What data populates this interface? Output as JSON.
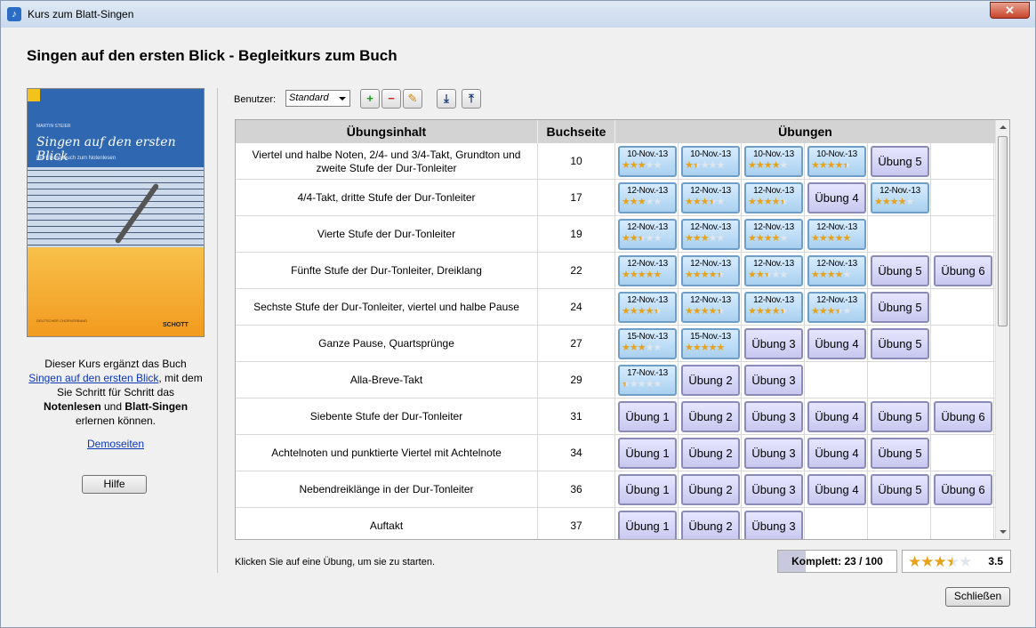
{
  "window": {
    "title": "Kurs zum Blatt-Singen",
    "close_glyph": "✕"
  },
  "page_title": "Singen auf den ersten Blick - Begleitkurs zum Buch",
  "cover": {
    "author": "MARTIN STEIER",
    "title": "Singen auf den ersten Blick",
    "subtitle": "Ein Übungsbuch zum Notenlesen",
    "logo_left": "DEUTSCHER CHORVERBAND",
    "logo_right": "SCHOTT"
  },
  "description": {
    "line1": "Dieser Kurs ergänzt das Buch",
    "link": "Singen auf den ersten Blick",
    "line2": ", mit dem Sie Schritt für Schritt das",
    "bold1": "Notenlesen",
    "and": " und ",
    "bold2": "Blatt-Singen",
    "line3": " erlernen können."
  },
  "demo_link": "Demoseiten",
  "help_button": "Hilfe",
  "toolbar": {
    "user_label": "Benutzer:",
    "user_value": "Standard",
    "add_icon": "+",
    "remove_icon": "−",
    "edit_icon": "✎",
    "save_icon": "⤓",
    "load_icon": "⤒"
  },
  "table": {
    "headers": [
      "Übungsinhalt",
      "Buchseite",
      "Übungen"
    ],
    "rows": [
      {
        "content": "Viertel und halbe Noten, 2/4- und 3/4-Takt, Grundton und zweite Stufe der Dur-Tonleiter",
        "page": "10",
        "exercises": [
          {
            "date": "10-Nov.-13",
            "stars": 3
          },
          {
            "date": "10-Nov.-13",
            "stars": 1.5
          },
          {
            "date": "10-Nov.-13",
            "stars": 4
          },
          {
            "date": "10-Nov.-13",
            "stars": 4.5
          },
          {
            "label": "Übung 5"
          }
        ]
      },
      {
        "content": "4/4-Takt, dritte Stufe der Dur-Tonleiter",
        "page": "17",
        "exercises": [
          {
            "date": "12-Nov.-13",
            "stars": 3
          },
          {
            "date": "12-Nov.-13",
            "stars": 3.5
          },
          {
            "date": "12-Nov.-13",
            "stars": 4.5
          },
          {
            "label": "Übung 4"
          },
          {
            "date": "12-Nov.-13",
            "stars": 4
          }
        ]
      },
      {
        "content": "Vierte Stufe der Dur-Tonleiter",
        "page": "19",
        "exercises": [
          {
            "date": "12-Nov.-13",
            "stars": 2.5
          },
          {
            "date": "12-Nov.-13",
            "stars": 3
          },
          {
            "date": "12-Nov.-13",
            "stars": 4
          },
          {
            "date": "12-Nov.-13",
            "stars": 5
          }
        ]
      },
      {
        "content": "Fünfte Stufe der Dur-Tonleiter, Dreiklang",
        "page": "22",
        "exercises": [
          {
            "date": "12-Nov.-13",
            "stars": 5
          },
          {
            "date": "12-Nov.-13",
            "stars": 4.5
          },
          {
            "date": "12-Nov.-13",
            "stars": 2.5
          },
          {
            "date": "12-Nov.-13",
            "stars": 4
          },
          {
            "label": "Übung 5"
          },
          {
            "label": "Übung 6"
          }
        ]
      },
      {
        "content": "Sechste Stufe der Dur-Tonleiter, viertel und halbe Pause",
        "page": "24",
        "exercises": [
          {
            "date": "12-Nov.-13",
            "stars": 4.5
          },
          {
            "date": "12-Nov.-13",
            "stars": 4.5
          },
          {
            "date": "12-Nov.-13",
            "stars": 4.5
          },
          {
            "date": "12-Nov.-13",
            "stars": 3.5
          },
          {
            "label": "Übung 5"
          }
        ]
      },
      {
        "content": "Ganze Pause, Quartsprünge",
        "page": "27",
        "exercises": [
          {
            "date": "15-Nov.-13",
            "stars": 3
          },
          {
            "date": "15-Nov.-13",
            "stars": 5
          },
          {
            "label": "Übung 3"
          },
          {
            "label": "Übung 4"
          },
          {
            "label": "Übung 5"
          }
        ]
      },
      {
        "content": "Alla-Breve-Takt",
        "page": "29",
        "exercises": [
          {
            "date": "17-Nov.-13",
            "stars": 0.5
          },
          {
            "label": "Übung 2"
          },
          {
            "label": "Übung 3"
          }
        ]
      },
      {
        "content": "Siebente Stufe der Dur-Tonleiter",
        "page": "31",
        "exercises": [
          {
            "label": "Übung 1"
          },
          {
            "label": "Übung 2"
          },
          {
            "label": "Übung 3"
          },
          {
            "label": "Übung 4"
          },
          {
            "label": "Übung 5"
          },
          {
            "label": "Übung 6"
          }
        ]
      },
      {
        "content": "Achtelnoten und punktierte Viertel mit Achtelnote",
        "page": "34",
        "exercises": [
          {
            "label": "Übung 1"
          },
          {
            "label": "Übung 2"
          },
          {
            "label": "Übung 3"
          },
          {
            "label": "Übung 4"
          },
          {
            "label": "Übung 5"
          }
        ]
      },
      {
        "content": "Nebendreiklänge in der Dur-Tonleiter",
        "page": "36",
        "exercises": [
          {
            "label": "Übung 1"
          },
          {
            "label": "Übung 2"
          },
          {
            "label": "Übung 3"
          },
          {
            "label": "Übung 4"
          },
          {
            "label": "Übung 5"
          },
          {
            "label": "Übung 6"
          }
        ]
      },
      {
        "content": "Auftakt",
        "page": "37",
        "exercises": [
          {
            "label": "Übung 1"
          },
          {
            "label": "Übung 2"
          },
          {
            "label": "Übung 3"
          }
        ]
      }
    ]
  },
  "status_hint": "Klicken Sie auf eine Übung, um sie zu starten.",
  "progress": {
    "label": "Komplett: 23 / 100",
    "done": 23,
    "total": 100
  },
  "overall_rating": {
    "stars": 3.5,
    "value": "3.5"
  },
  "close_button": "Schließen",
  "colors": {
    "accent_blue": "#2f67b0",
    "done_cell": "#a9d0ef",
    "open_cell": "#c8c8f0",
    "star": "#e6a21a"
  }
}
